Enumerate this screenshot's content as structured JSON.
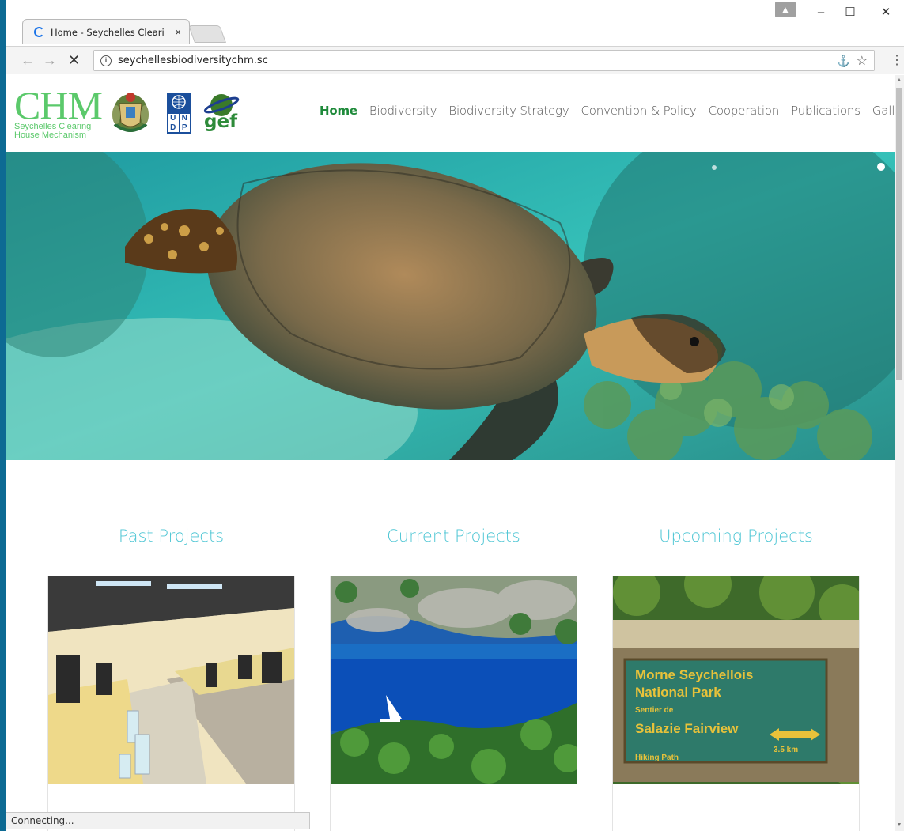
{
  "browser": {
    "tab_title": "Home - Seychelles Cleari",
    "tab_close": "×",
    "url": "seychellesbiodiversitychm.sc",
    "back": "←",
    "forward": "→",
    "stop": "✕",
    "info": "i",
    "star": "☆",
    "extension": "🧩",
    "menu": "⋮",
    "minimize": "–",
    "maximize": "☐",
    "close": "✕",
    "status_text": "Connecting..."
  },
  "site": {
    "logo_big": "CHM",
    "logo_line1": "Seychelles Clearing",
    "logo_line2": "House Mechanism",
    "undp": [
      "U",
      "N",
      "D",
      "P"
    ],
    "gef": "gef",
    "nav": [
      "Home",
      "Biodiversity",
      "Biodiversity Strategy",
      "Convention & Policy",
      "Cooperation",
      "Publications",
      "Gallery"
    ]
  },
  "projects": [
    {
      "title": "Past Projects"
    },
    {
      "title": "Current Projects"
    },
    {
      "title": "Upcoming Projects"
    }
  ],
  "sign": {
    "line1": "Morne Seychellois",
    "line2": "National Park",
    "line3": "Sentier de",
    "line4": "Salazie Fairview",
    "line5": "Hiking Path",
    "distance": "3.5 km"
  },
  "colors": {
    "accent": "#4ec6d4",
    "nav_active": "#1e8a3a",
    "logo_green": "#5bc96b"
  }
}
